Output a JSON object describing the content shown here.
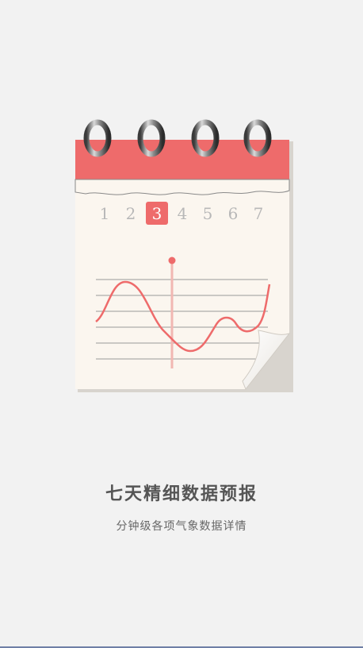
{
  "calendar": {
    "day_numbers": [
      "1",
      "2",
      "3",
      "4",
      "5",
      "6",
      "7"
    ],
    "selected_day_index": 2
  },
  "colors": {
    "accent": "#ee6b6b",
    "paper": "#fbf6ef",
    "background": "#f2f2f2"
  },
  "intro": {
    "title": "七天精细数据预报",
    "subtitle": "分钟级各项气象数据详情"
  }
}
